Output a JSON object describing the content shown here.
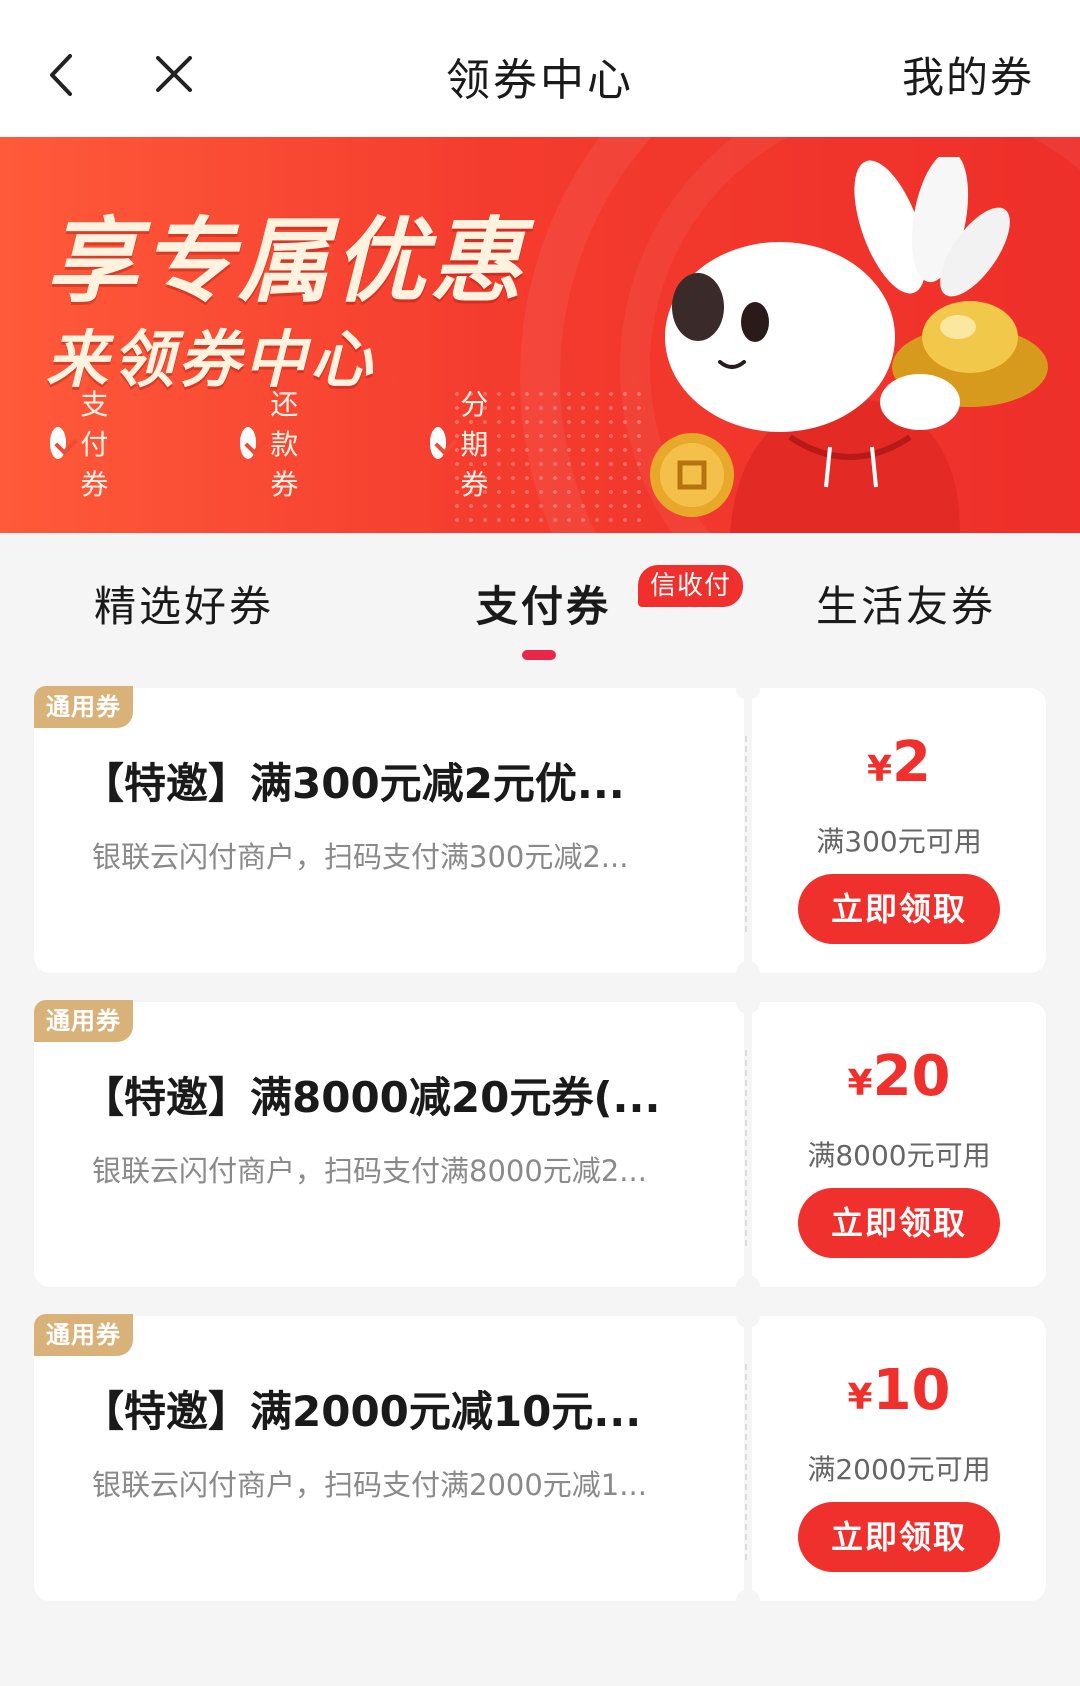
{
  "header": {
    "title": "领券中心",
    "my_coupons": "我的券"
  },
  "banner": {
    "headline": "享专属优惠",
    "subline": "来领券中心",
    "tags": [
      "支付券",
      "还款券",
      "分期券"
    ]
  },
  "tabs": [
    {
      "label": "精选好券"
    },
    {
      "label": "支付券",
      "badge": "信收付"
    },
    {
      "label": "生活友券"
    }
  ],
  "coupons": [
    {
      "badge": "通用券",
      "title": "【特邀】满300元减2元优...",
      "desc": "银联云闪付商户，扫码支付满300元减2...",
      "currency": "¥",
      "amount": "2",
      "condition": "满300元可用",
      "button": "立即领取"
    },
    {
      "badge": "通用券",
      "title": "【特邀】满8000减20元券(...",
      "desc": "银联云闪付商户，扫码支付满8000元减2...",
      "currency": "¥",
      "amount": "20",
      "condition": "满8000元可用",
      "button": "立即领取"
    },
    {
      "badge": "通用券",
      "title": "【特邀】满2000元减10元...",
      "desc": "银联云闪付商户，扫码支付满2000元减1...",
      "currency": "¥",
      "amount": "10",
      "condition": "满2000元可用",
      "button": "立即领取"
    }
  ],
  "colors": {
    "accent": "#f0302c",
    "badge_gold": "#d9b27a",
    "tab_indicator": "#e8284a"
  }
}
